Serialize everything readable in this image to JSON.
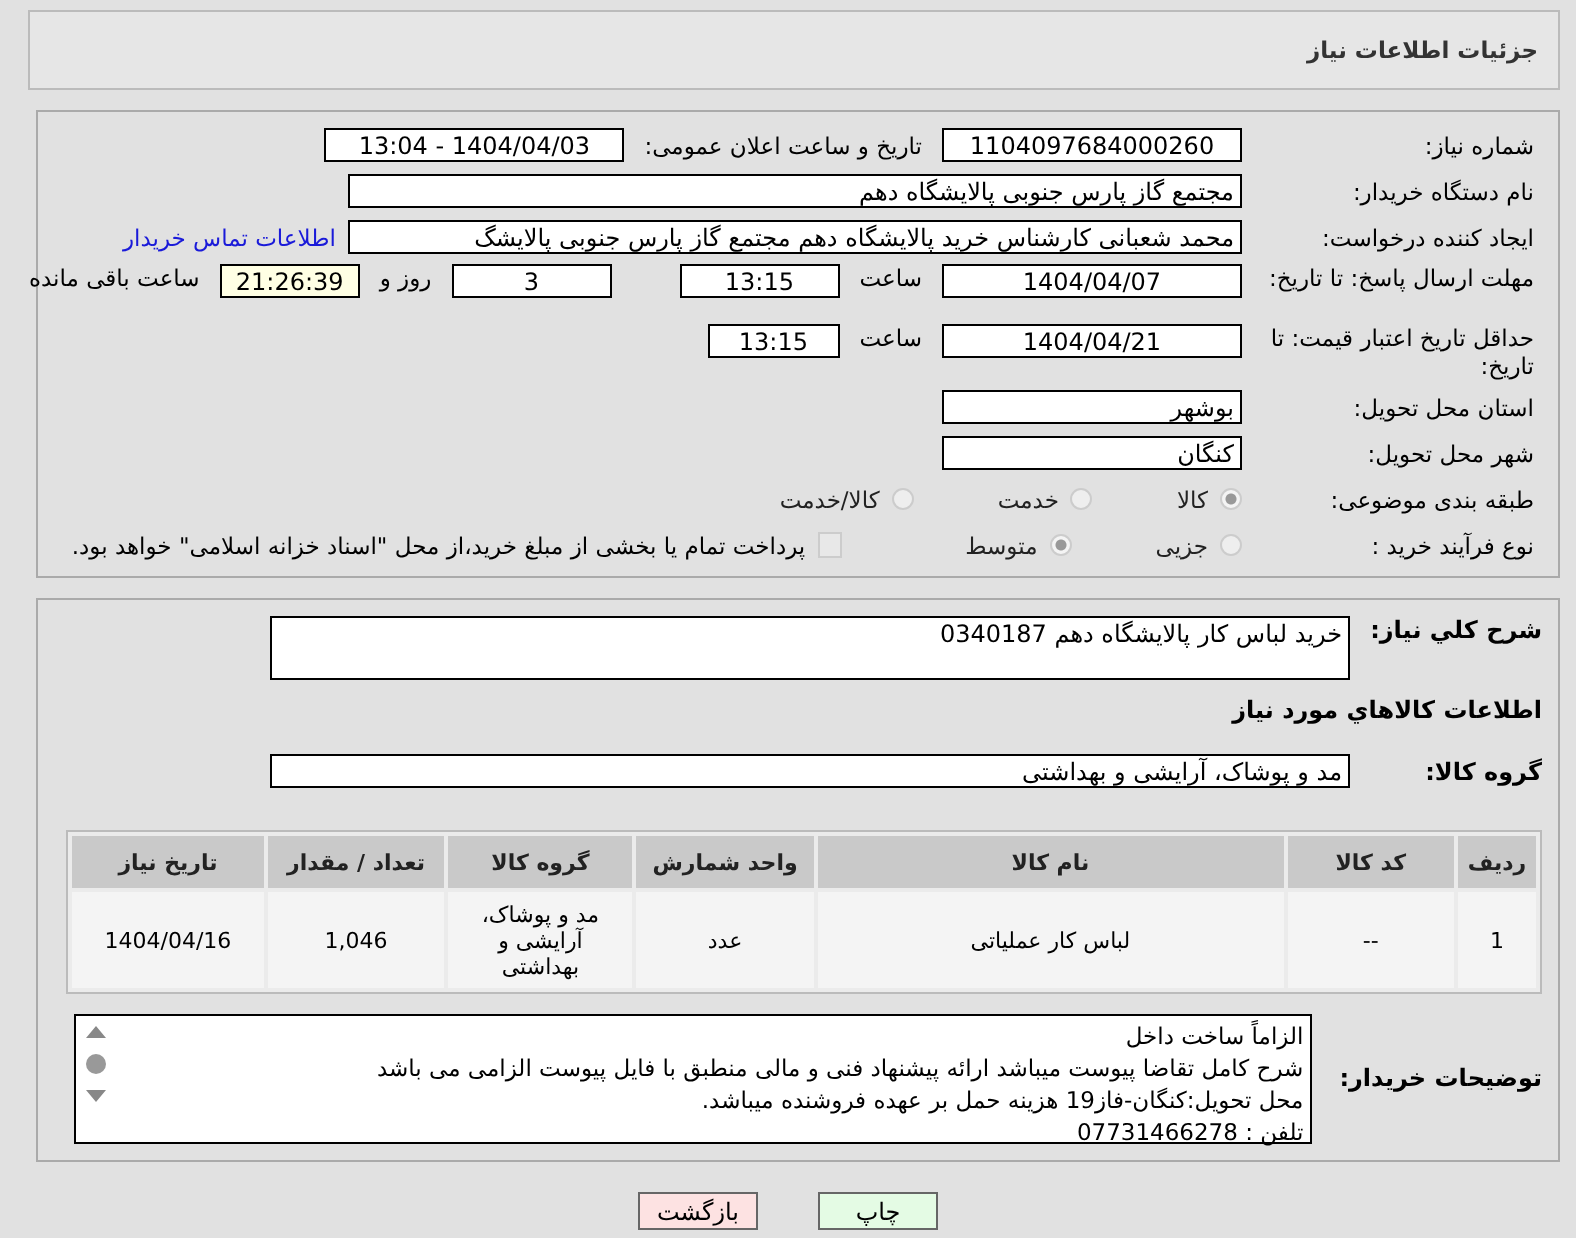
{
  "header": {
    "title": "جزئیات اطلاعات نیاز"
  },
  "need_number": {
    "label": "شماره نیاز:",
    "value": "1104097684000260"
  },
  "announce": {
    "label": "تاریخ و ساعت اعلان عمومی:",
    "value": "1404/04/03 - 13:04"
  },
  "buyer_org": {
    "label": "نام دستگاه خریدار:",
    "value": "مجتمع گاز پارس جنوبی  پالایشگاه دهم"
  },
  "requester": {
    "label": "ایجاد کننده درخواست:",
    "value": "محمد شعبانی کارشناس خرید پالایشگاه دهم  مجتمع گاز پارس جنوبی  پالایشگ",
    "link": "اطلاعات تماس خریدار"
  },
  "reply_deadline": {
    "label": "مهلت ارسال پاسخ: تا تاریخ:",
    "date": "1404/04/07",
    "time_label": "ساعت",
    "time": "13:15",
    "days": "3",
    "days_label": "روز و",
    "remaining": "21:26:39",
    "remaining_label": "ساعت باقی مانده"
  },
  "price_validity": {
    "label": "حداقل تاریخ اعتبار قیمت: تا تاریخ:",
    "date": "1404/04/21",
    "time_label": "ساعت",
    "time": "13:15"
  },
  "province": {
    "label": "استان محل تحویل:",
    "value": "بوشهر"
  },
  "city": {
    "label": "شهر محل تحویل:",
    "value": "کنگان"
  },
  "category": {
    "label": "طبقه بندی موضوعی:",
    "options": [
      {
        "label": "کالا",
        "selected": true
      },
      {
        "label": "خدمت",
        "selected": false
      },
      {
        "label": "کالا/خدمت",
        "selected": false
      }
    ]
  },
  "process": {
    "label": "نوع فرآیند خرید :",
    "options": [
      {
        "label": "جزیی",
        "selected": false
      },
      {
        "label": "متوسط",
        "selected": true
      }
    ],
    "payment": {
      "label": "پرداخت تمام یا بخشی از مبلغ خرید،از محل \"اسناد خزانه اسلامی\" خواهد بود.",
      "checked": false,
      "disabled": true
    }
  },
  "summary": {
    "label": "شرح کلي نياز:",
    "value": "خرید لباس کار پالایشگاه دهم 0340187"
  },
  "goods_title": "اطلاعات کالاهاي مورد نياز",
  "goods_group": {
    "label": "گروه کالا:",
    "value": "مد و پوشاک، آرایشی و بهداشتی"
  },
  "table": {
    "columns": [
      "ردیف",
      "کد کالا",
      "نام کالا",
      "واحد شمارش",
      "گروه کالا",
      "تعداد / مقدار",
      "تاریخ نیاز"
    ],
    "rows": [
      [
        "1",
        "--",
        "لباس کار عملیاتی",
        "عدد",
        "مد و پوشاک، آرایشی و بهداشتی",
        "1,046",
        "1404/04/16"
      ]
    ]
  },
  "buyer_notes": {
    "label": "توضیحات خریدار:",
    "lines": [
      "الزاماً ساخت داخل",
      "شرح کامل تقاضا پیوست میباشد ارائه پیشنهاد فنی و مالی منطبق با فایل پیوست الزامی می باشد",
      "محل تحویل:کنگان-فاز19 هزینه حمل بر عهده فروشنده میباشد.",
      "تلفن : 07731466278"
    ]
  },
  "buttons": [
    {
      "label": "چاپ",
      "kind": "print"
    },
    {
      "label": "بازگشت",
      "kind": "back"
    }
  ]
}
